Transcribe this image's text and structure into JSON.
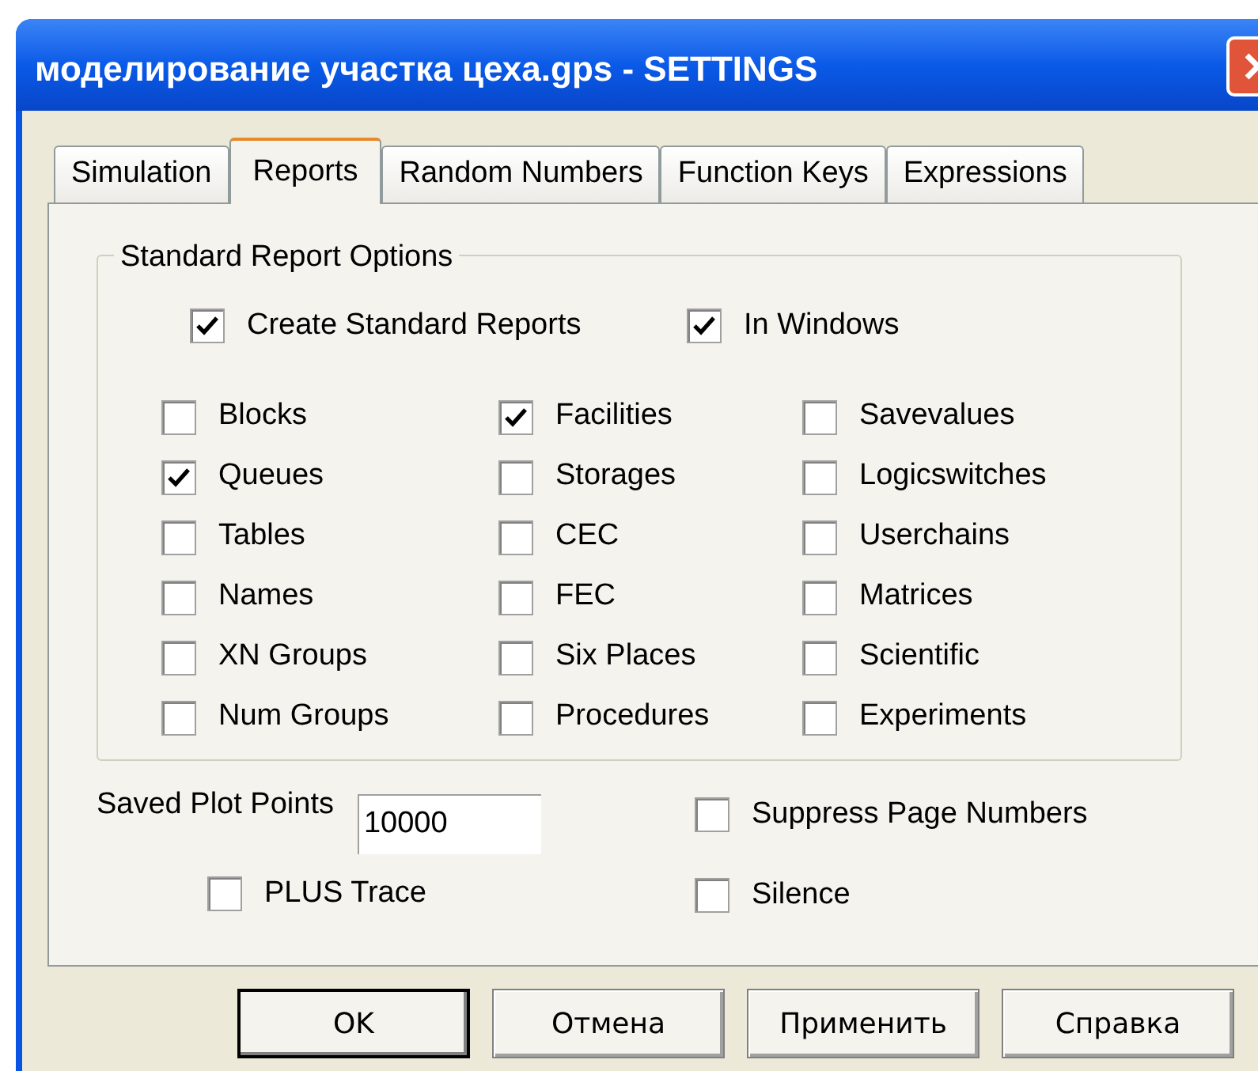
{
  "window": {
    "title": "моделирование участка цеха.gps - SETTINGS"
  },
  "tabs": [
    {
      "label": "Simulation",
      "selected": false
    },
    {
      "label": "Reports",
      "selected": true
    },
    {
      "label": "Random Numbers",
      "selected": false
    },
    {
      "label": "Function Keys",
      "selected": false
    },
    {
      "label": "Expressions",
      "selected": false
    }
  ],
  "group": {
    "title": "Standard Report Options",
    "top_options": [
      {
        "label": "Create Standard Reports",
        "checked": true
      },
      {
        "label": "In Windows",
        "checked": true
      }
    ],
    "options": [
      {
        "label": "Blocks",
        "checked": false
      },
      {
        "label": "Facilities",
        "checked": true
      },
      {
        "label": "Savevalues",
        "checked": false
      },
      {
        "label": "Queues",
        "checked": true
      },
      {
        "label": "Storages",
        "checked": false
      },
      {
        "label": "Logicswitches",
        "checked": false
      },
      {
        "label": "Tables",
        "checked": false
      },
      {
        "label": "CEC",
        "checked": false
      },
      {
        "label": "Userchains",
        "checked": false
      },
      {
        "label": "Names",
        "checked": false
      },
      {
        "label": "FEC",
        "checked": false
      },
      {
        "label": "Matrices",
        "checked": false
      },
      {
        "label": "XN Groups",
        "checked": false
      },
      {
        "label": "Six Places",
        "checked": false
      },
      {
        "label": "Scientific",
        "checked": false
      },
      {
        "label": "Num Groups",
        "checked": false
      },
      {
        "label": "Procedures",
        "checked": false
      },
      {
        "label": "Experiments",
        "checked": false
      }
    ]
  },
  "saved_plot_points": {
    "label": "Saved Plot Points",
    "value": "10000"
  },
  "plus_trace": {
    "label": "PLUS Trace",
    "checked": false
  },
  "suppress_page_numbers": {
    "label": "Suppress Page Numbers",
    "checked": false
  },
  "silence": {
    "label": "Silence",
    "checked": false
  },
  "buttons": [
    {
      "label": "OK",
      "default": true
    },
    {
      "label": "Отмена",
      "default": false
    },
    {
      "label": "Применить",
      "default": false
    },
    {
      "label": "Справка",
      "default": false
    }
  ]
}
